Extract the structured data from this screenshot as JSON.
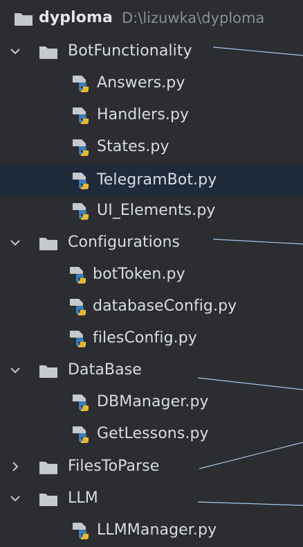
{
  "root": {
    "name": "dyploma",
    "path": "D:\\lizuwka\\dyploma"
  },
  "tree": [
    {
      "type": "folder",
      "label": "BotFunctionality",
      "expanded": true
    },
    {
      "type": "file",
      "label": "Answers.py"
    },
    {
      "type": "file",
      "label": "Handlers.py"
    },
    {
      "type": "file",
      "label": "States.py"
    },
    {
      "type": "file",
      "label": "TelegramBot.py",
      "selected": true
    },
    {
      "type": "file",
      "label": "UI_Elements.py"
    },
    {
      "type": "folder",
      "label": "Configurations",
      "expanded": true
    },
    {
      "type": "file",
      "label": "botToken.py"
    },
    {
      "type": "file",
      "label": "databaseConfig.py"
    },
    {
      "type": "file",
      "label": "filesConfig.py"
    },
    {
      "type": "folder",
      "label": "DataBase",
      "expanded": true
    },
    {
      "type": "file",
      "label": "DBManager.py"
    },
    {
      "type": "file",
      "label": "GetLessons.py"
    },
    {
      "type": "folder",
      "label": "FilesToParse",
      "expanded": false
    },
    {
      "type": "folder",
      "label": "LLM",
      "expanded": true
    },
    {
      "type": "file",
      "label": "LLMManager.py"
    }
  ],
  "colors": {
    "background": "#2b2d30",
    "selected_row": "#1f2a3a",
    "folder": "#c5c8cd",
    "annotation_line": "#a9c7e8"
  }
}
